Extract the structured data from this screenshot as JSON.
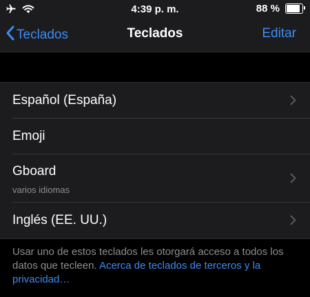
{
  "status_bar": {
    "time": "4:39 p. m.",
    "battery_text": "88 %",
    "battery_level": 0.88,
    "icons": [
      "airplane-icon",
      "wifi-icon",
      "battery-icon"
    ]
  },
  "nav": {
    "back_label": "Teclados",
    "title": "Teclados",
    "edit_label": "Editar"
  },
  "keyboards": [
    {
      "label": "Español (España)",
      "subtitle": "",
      "has_chevron": true
    },
    {
      "label": "Emoji",
      "subtitle": "",
      "has_chevron": false
    },
    {
      "label": "Gboard",
      "subtitle": "varios idiomas",
      "has_chevron": true
    },
    {
      "label": "Inglés (EE. UU.)",
      "subtitle": "",
      "has_chevron": true
    }
  ],
  "footer": {
    "text": "Usar uno de estos teclados les otorgará acceso a todos los datos que tecleen. ",
    "link": "Acerca de teclados de terceros y la privacidad…"
  },
  "colors": {
    "background": "#000000",
    "surface": "#1c1c1e",
    "accent": "#3d8cf5",
    "secondary_text": "#8e8e93"
  }
}
